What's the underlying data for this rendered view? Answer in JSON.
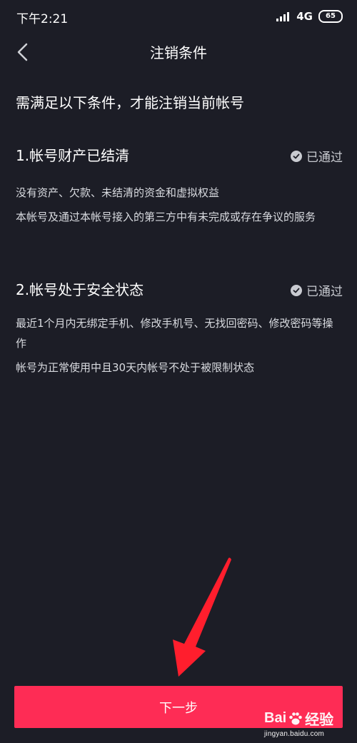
{
  "status_bar": {
    "time": "下午2:21",
    "network": "4G",
    "battery": "65"
  },
  "nav": {
    "title": "注销条件"
  },
  "intro": "需满足以下条件，才能注销当前帐号",
  "conditions": [
    {
      "title": "1.帐号财产已结清",
      "status": "已通过",
      "details": [
        "没有资产、欠款、未结清的资金和虚拟权益",
        "本帐号及通过本帐号接入的第三方中有未完成或存在争议的服务"
      ]
    },
    {
      "title": "2.帐号处于安全状态",
      "status": "已通过",
      "details": [
        "最近1个月内无绑定手机、修改手机号、无找回密码、修改密码等操作",
        "帐号为正常使用中且30天内帐号不处于被限制状态"
      ]
    }
  ],
  "next_button": "下一步",
  "watermark": {
    "brand_bai": "Bai",
    "brand_jingyan": "经验",
    "site": "jingyan.baidu.com"
  },
  "colors": {
    "background": "#1c1d26",
    "accent": "#fe2c55",
    "annotation_arrow": "#ff1e2d"
  }
}
